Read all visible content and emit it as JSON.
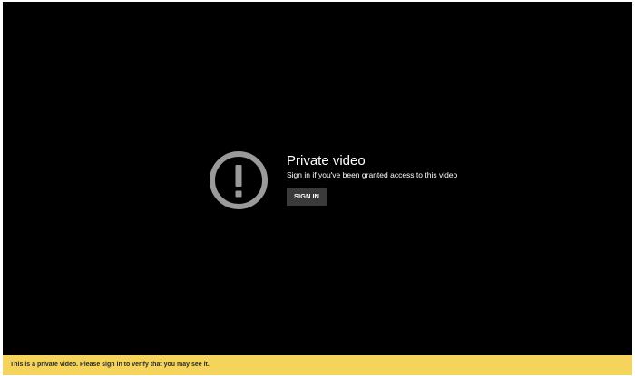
{
  "player": {
    "title": "Private video",
    "subtitle": "Sign in if you've been granted access to this video",
    "sign_in_button": "SIGN IN",
    "icon": "exclamation-circle-icon",
    "background_color": "#000000",
    "icon_color": "#9a9a9a",
    "button_color": "#3a3a3a"
  },
  "notice": {
    "text": "This is a private video. Please sign in to verify that you may see it.",
    "background_color": "#f5d45b"
  }
}
